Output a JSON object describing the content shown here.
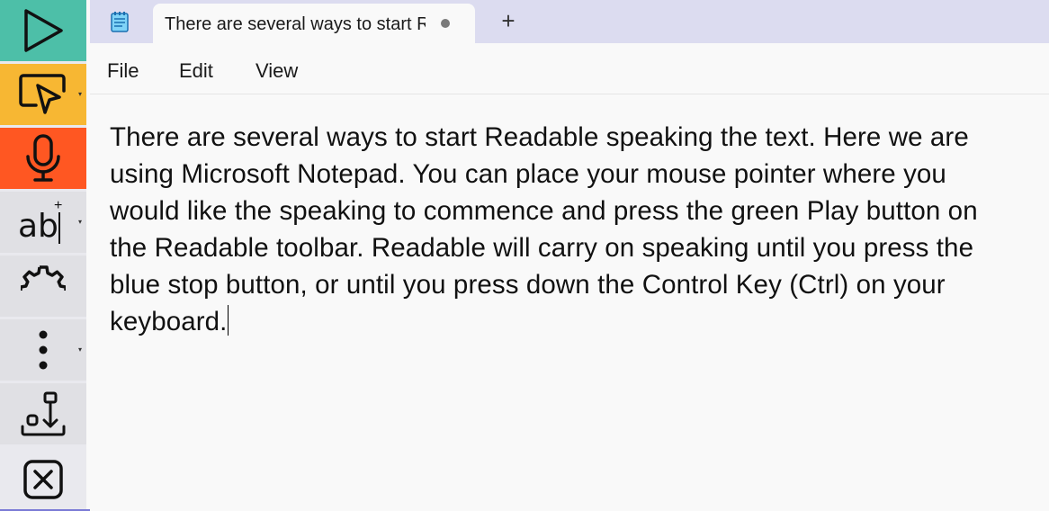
{
  "toolbar": {
    "buttons": [
      {
        "name": "play",
        "icon": "play-icon",
        "color": "#4dbfa8"
      },
      {
        "name": "select",
        "icon": "screen-pointer-icon",
        "color": "#f7b733"
      },
      {
        "name": "microphone",
        "icon": "microphone-icon",
        "color": "#ff5722"
      },
      {
        "name": "dictionary",
        "icon": "text-cursor-ab-icon"
      },
      {
        "name": "settings",
        "icon": "gear-icon"
      },
      {
        "name": "more",
        "icon": "more-vertical-icon"
      },
      {
        "name": "save-audio",
        "icon": "download-tray-icon"
      },
      {
        "name": "close",
        "icon": "close-icon"
      }
    ],
    "ab_label": "ab"
  },
  "tabbar": {
    "tab_title": "There are several ways to start Readable speaking the text.",
    "new_tab_label": "+"
  },
  "menu": {
    "file": "File",
    "edit": "Edit",
    "view": "View"
  },
  "editor": {
    "text": "There are several ways to start Readable speaking the text. Here we are using Microsoft Notepad. You can place your mouse pointer where you would like the speaking to commence and press the green Play button on the Readable toolbar. Readable will carry on speaking until you press the blue stop button, or until you press down the Control Key (Ctrl) on your keyboard."
  }
}
